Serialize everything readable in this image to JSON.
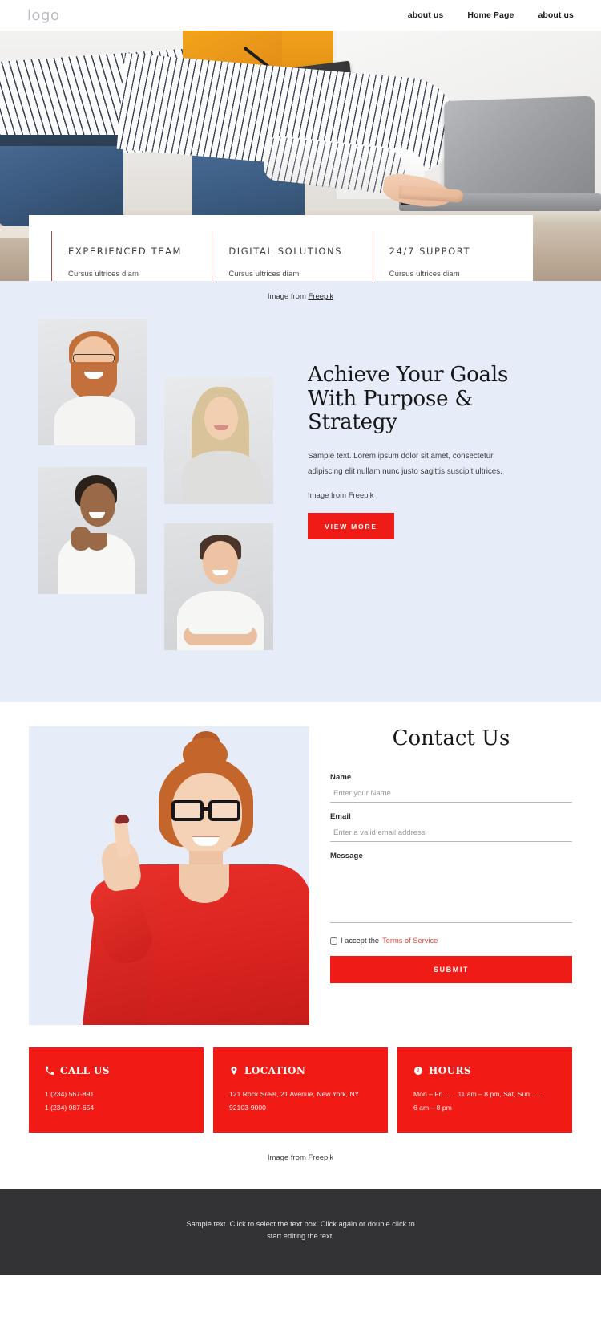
{
  "header": {
    "logo": "logo",
    "nav": [
      {
        "label": "about us"
      },
      {
        "label": "Home Page"
      },
      {
        "label": "about us"
      }
    ]
  },
  "hero": {
    "features": [
      {
        "title": "EXPERIENCED TEAM",
        "subtitle": "Cursus ultrices diam"
      },
      {
        "title": "DIGITAL SOLUTIONS",
        "subtitle": "Cursus ultrices diam"
      },
      {
        "title": "24/7 SUPPORT",
        "subtitle": "Cursus ultrices diam"
      }
    ],
    "attribution_prefix": "Image from ",
    "attribution_link": "Freepik"
  },
  "team": {
    "heading": "Achieve Your Goals With Purpose & Strategy",
    "paragraph": "Sample text. Lorem ipsum dolor sit amet, consectetur adipiscing elit nullam nunc justo sagittis suscipit ultrices.",
    "attribution_prefix": "Image from ",
    "attribution_link": "Freepik",
    "cta_label": "VIEW MORE"
  },
  "contact": {
    "heading": "Contact Us",
    "fields": {
      "name_label": "Name",
      "name_placeholder": "Enter your Name",
      "name_value": "",
      "email_label": "Email",
      "email_placeholder": "Enter a valid email address",
      "email_value": "",
      "message_label": "Message",
      "message_placeholder": "",
      "message_value": ""
    },
    "accept_text": "I accept the ",
    "terms_label": "Terms of Service",
    "submit_label": "SUBMIT"
  },
  "info_cards": [
    {
      "icon": "phone-icon",
      "title": "CALL US",
      "lines": [
        "1 (234) 567-891,",
        "1 (234) 987-654"
      ]
    },
    {
      "icon": "location-pin-icon",
      "title": "LOCATION",
      "lines": [
        "121 Rock Sreet, 21 Avenue, New York, NY",
        "92103-9000"
      ]
    },
    {
      "icon": "clock-icon",
      "title": "HOURS",
      "lines": [
        "Mon – Fri ...... 11 am – 8 pm, Sat, Sun  ......",
        "6 am – 8 pm"
      ]
    }
  ],
  "bottom": {
    "attribution_prefix": "Image from ",
    "attribution_link": "Freepik"
  },
  "footer": {
    "text": "Sample text. Click to select the text box. Click again or double click to start editing the text."
  },
  "colors": {
    "accent_red": "#ef1b16",
    "card_red": "#f21a15",
    "band_blue": "#e6edf8",
    "footer_dark": "#333335"
  }
}
